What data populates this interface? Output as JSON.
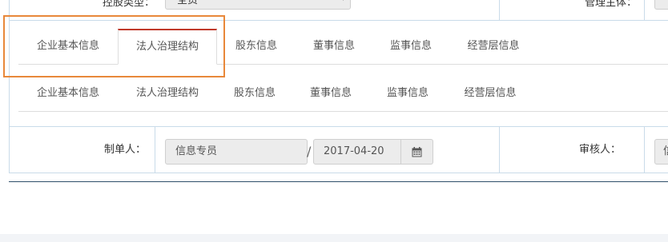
{
  "top_row": {
    "label_left": "控股类型：",
    "select_value": "全资",
    "label_right": "管理主体："
  },
  "tabs_primary": [
    {
      "label": "企业基本信息",
      "active": false
    },
    {
      "label": "法人治理结构",
      "active": true
    },
    {
      "label": "股东信息",
      "active": false
    },
    {
      "label": "董事信息",
      "active": false
    },
    {
      "label": "监事信息",
      "active": false
    },
    {
      "label": "经营层信息",
      "active": false
    }
  ],
  "tabs_secondary": [
    {
      "label": "企业基本信息"
    },
    {
      "label": "法人治理结构"
    },
    {
      "label": "股东信息"
    },
    {
      "label": "董事信息"
    },
    {
      "label": "监事信息"
    },
    {
      "label": "经营层信息"
    }
  ],
  "form": {
    "creator_label": "制单人：",
    "creator_value": "信息专员",
    "date_separator": "/",
    "date_value": "2017-04-20",
    "reviewer_label": "审核人：",
    "reviewer_value": "信"
  },
  "colors": {
    "active_tab_top": "#c0392b",
    "highlight_box": "#e8883a",
    "border": "#c9dbe9",
    "bottom_rule": "#2f4f6a"
  },
  "icons": {
    "calendar": "calendar-icon",
    "select_arrow": "chevron-down-icon"
  }
}
